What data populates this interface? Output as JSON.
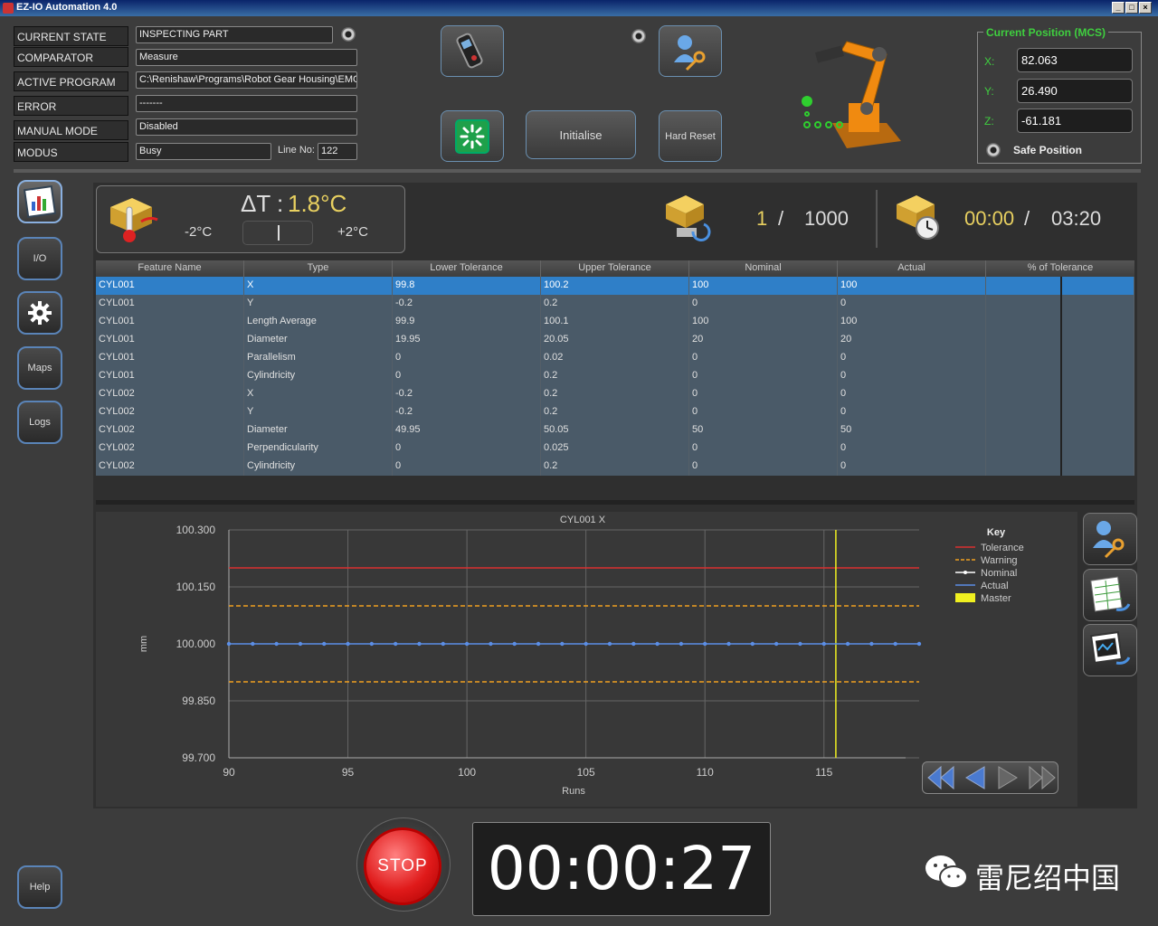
{
  "app": {
    "title": "EZ-IO Automation 4.0"
  },
  "status": {
    "rows": [
      {
        "label": "CURRENT STATE",
        "value": "INSPECTING PART"
      },
      {
        "label": "COMPARATOR",
        "value": "Measure"
      },
      {
        "label": "ACTIVE PROGRAM",
        "value": "C:\\Renishaw\\Programs\\Robot Gear Housing\\EMO"
      },
      {
        "label": "ERROR",
        "value": "-------"
      },
      {
        "label": "MANUAL MODE",
        "value": "Disabled"
      },
      {
        "label": "MODUS",
        "value": "Busy"
      }
    ],
    "line_no_label": "Line No:",
    "line_no_value": "122"
  },
  "controls": {
    "initialise_label": "Initialise",
    "hard_reset_label": "Hard Reset"
  },
  "position": {
    "title": "Current Position (MCS)",
    "x_label": "X:",
    "x_value": "82.063",
    "y_label": "Y:",
    "y_value": "26.490",
    "z_label": "Z:",
    "z_value": "-61.181",
    "safe_label": "Safe Position"
  },
  "nav": {
    "io": "I/O",
    "maps": "Maps",
    "logs": "Logs",
    "help": "Help"
  },
  "temperature": {
    "delta_label": "ΔT :",
    "delta_value": "1.8°C",
    "min": "-2°C",
    "max": "+2°C",
    "level": 0.5
  },
  "counter": {
    "current": "1",
    "sep": "/",
    "total": "1000"
  },
  "cycle": {
    "elapsed": "00:00",
    "sep": "/",
    "total": "03:20"
  },
  "table": {
    "headers": [
      "Feature Name",
      "Type",
      "Lower Tolerance",
      "Upper Tolerance",
      "Nominal",
      "Actual",
      "% of Tolerance"
    ],
    "rows": [
      [
        "CYL001",
        "X",
        "99.8",
        "100.2",
        "100",
        "100",
        ""
      ],
      [
        "CYL001",
        "Y",
        "-0.2",
        "0.2",
        "0",
        "0",
        ""
      ],
      [
        "CYL001",
        "Length Average",
        "99.9",
        "100.1",
        "100",
        "100",
        ""
      ],
      [
        "CYL001",
        "Diameter",
        "19.95",
        "20.05",
        "20",
        "20",
        ""
      ],
      [
        "CYL001",
        "Parallelism",
        "0",
        "0.02",
        "0",
        "0",
        ""
      ],
      [
        "CYL001",
        "Cylindricity",
        "0",
        "0.2",
        "0",
        "0",
        ""
      ],
      [
        "CYL002",
        "X",
        "-0.2",
        "0.2",
        "0",
        "0",
        ""
      ],
      [
        "CYL002",
        "Y",
        "-0.2",
        "0.2",
        "0",
        "0",
        ""
      ],
      [
        "CYL002",
        "Diameter",
        "49.95",
        "50.05",
        "50",
        "50",
        ""
      ],
      [
        "CYL002",
        "Perpendicularity",
        "0",
        "0.025",
        "0",
        "0",
        ""
      ],
      [
        "CYL002",
        "Cylindricity",
        "0",
        "0.2",
        "0",
        "0",
        ""
      ]
    ]
  },
  "chart_data": {
    "type": "line",
    "title": "CYL001 X",
    "xlabel": "Runs",
    "ylabel": "mm",
    "xlim": [
      90,
      119
    ],
    "ylim": [
      99.7,
      100.3
    ],
    "x_ticks": [
      90,
      95,
      100,
      105,
      110,
      115
    ],
    "y_ticks": [
      "99.700",
      "99.850",
      "100.000",
      "100.150",
      "100.300"
    ],
    "grid": true,
    "legend_title": "Key",
    "legend_position": "right",
    "reference_lines": [
      {
        "name": "Tolerance",
        "y": 100.2,
        "color": "#d93030",
        "style": "solid"
      },
      {
        "name": "Warning",
        "y": 100.1,
        "color": "#f0a020",
        "style": "dashed"
      },
      {
        "name": "Warning",
        "y": 99.9,
        "color": "#f0a020",
        "style": "dashed"
      }
    ],
    "legend": [
      {
        "name": "Tolerance",
        "color": "#d93030",
        "style": "solid"
      },
      {
        "name": "Warning",
        "color": "#f0a020",
        "style": "dashed"
      },
      {
        "name": "Nominal",
        "color": "#ffffff",
        "style": "marker"
      },
      {
        "name": "Actual",
        "color": "#5b8ee6",
        "style": "solid"
      },
      {
        "name": "Master",
        "color": "#f0f020",
        "style": "block"
      }
    ],
    "series": [
      {
        "name": "Actual",
        "color": "#5b8ee6",
        "x": [
          90,
          91,
          92,
          93,
          94,
          95,
          96,
          97,
          98,
          99,
          100,
          101,
          102,
          103,
          104,
          105,
          106,
          107,
          108,
          109,
          110,
          111,
          112,
          113,
          114,
          115,
          116,
          117,
          118,
          119
        ],
        "values": [
          100,
          100,
          100,
          100,
          100,
          100,
          100,
          100,
          100,
          100,
          100,
          100,
          100,
          100,
          100,
          100,
          100,
          100,
          100,
          100,
          100,
          100,
          100,
          100,
          100,
          100,
          100,
          100,
          100,
          100
        ]
      }
    ],
    "master_run": 115.5
  },
  "run_timer": "00:00:27",
  "stop_label": "STOP",
  "watermark": "雷尼绍中国",
  "colors": {
    "accent_green": "#3fcf3f",
    "selection_blue": "#2f7fc8",
    "counter_yellow": "#e8d060"
  }
}
